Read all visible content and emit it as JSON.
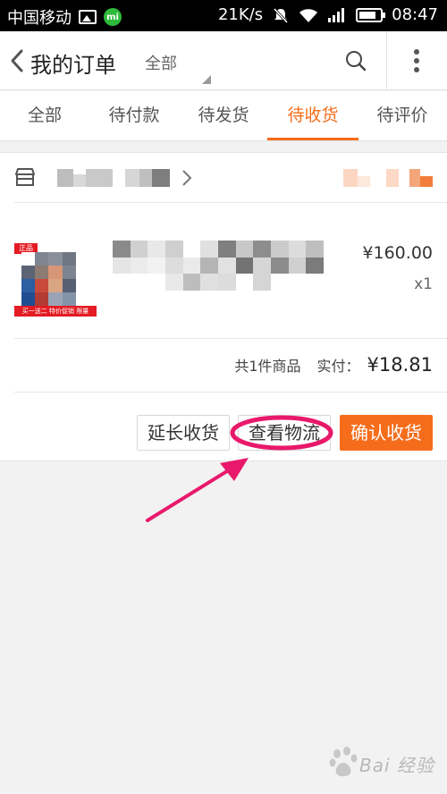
{
  "status_bar": {
    "carrier": "中国移动",
    "speed": "21K/s",
    "time": "08:47",
    "icons": [
      "image-icon",
      "mi-icon",
      "mute-icon",
      "wifi-icon",
      "signal-icon",
      "battery-icon"
    ]
  },
  "header": {
    "title": "我的订单",
    "filter_label": "全部",
    "icons": [
      "back-icon",
      "search-icon",
      "more-icon"
    ]
  },
  "tabs": [
    {
      "label": "全部",
      "active": false
    },
    {
      "label": "待付款",
      "active": false
    },
    {
      "label": "待发货",
      "active": false
    },
    {
      "label": "待收货",
      "active": true
    },
    {
      "label": "待评价",
      "active": false
    }
  ],
  "order": {
    "shop_icon": "store-icon",
    "product": {
      "badge": "正品",
      "strip": "买一送二 特价促销 限量"
    },
    "price": "¥160.00",
    "qty": "x1",
    "summary": {
      "count": "共1件商品",
      "paid_label": "实付：",
      "paid_value": "¥18.81"
    },
    "buttons": {
      "extend": "延长收货",
      "logistics": "查看物流",
      "confirm": "确认收货"
    }
  },
  "colors": {
    "accent": "#f56d1b",
    "annotation": "#e8196b",
    "background": "#f2f2f2"
  },
  "watermark": {
    "text": "Bai 经验"
  }
}
